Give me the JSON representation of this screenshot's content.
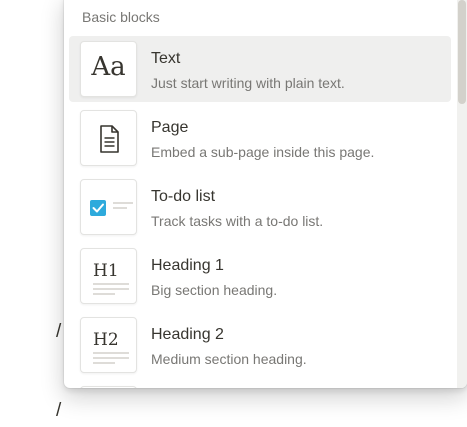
{
  "editor": {
    "slash_upper": "/",
    "slash_lower": "/"
  },
  "menu": {
    "section_title": "Basic blocks",
    "items": [
      {
        "title": "Text",
        "description": "Just start writing with plain text.",
        "icon": "text-aa-icon",
        "glyph": "Aa",
        "selected": true
      },
      {
        "title": "Page",
        "description": "Embed a sub-page inside this page.",
        "icon": "page-document-icon",
        "selected": false
      },
      {
        "title": "To-do list",
        "description": "Track tasks with a to-do list.",
        "icon": "todo-checkbox-icon",
        "selected": false
      },
      {
        "title": "Heading 1",
        "description": "Big section heading.",
        "icon": "heading-1-icon",
        "glyph": "H1",
        "selected": false
      },
      {
        "title": "Heading 2",
        "description": "Medium section heading.",
        "icon": "heading-2-icon",
        "glyph": "H2",
        "selected": false
      }
    ]
  },
  "colors": {
    "hover_background": "#efefee",
    "text_primary": "#37352f",
    "text_secondary": "#787774",
    "checkbox_blue": "#2eaadc"
  }
}
